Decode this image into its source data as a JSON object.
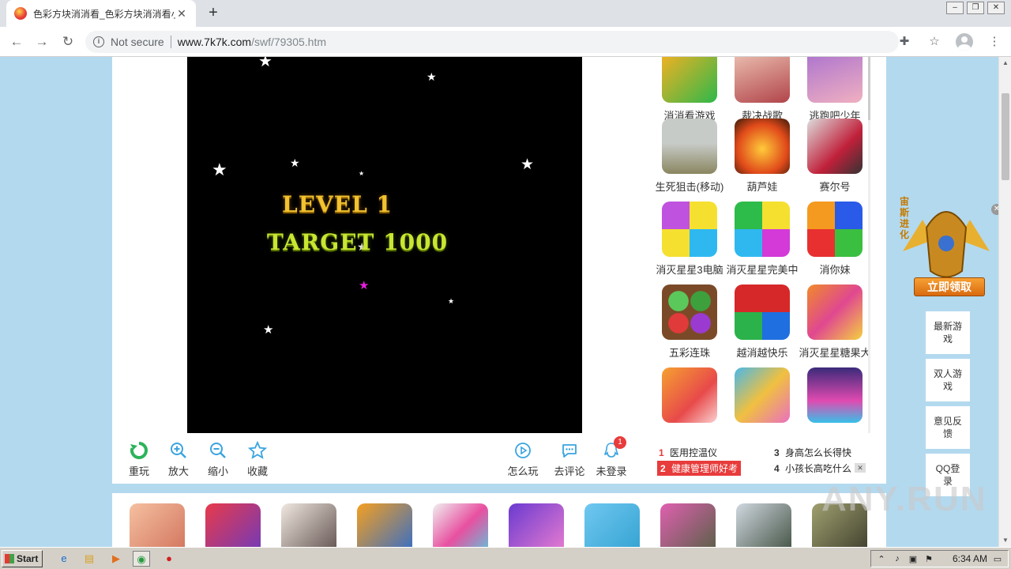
{
  "browser": {
    "tab_title": "色彩方块消消看_色彩方块消消看小游戏",
    "tab_close": "✕",
    "new_tab": "+",
    "security_label": "Not secure",
    "url_host": "www.7k7k.com",
    "url_path": "/swf/79305.htm"
  },
  "game": {
    "level_text": "LEVEL 1",
    "target_text": "TARGET 1000"
  },
  "controls": {
    "replay": "重玩",
    "zoom_in": "放大",
    "zoom_out": "缩小",
    "favorite": "收藏",
    "how_to_play": "怎么玩",
    "comment": "去评论",
    "login": "未登录",
    "login_badge": "1"
  },
  "sidebar_games": [
    {
      "name": "消消看游戏"
    },
    {
      "name": "裁决战歌"
    },
    {
      "name": "逃跑吧少年"
    },
    {
      "name": "生死狙击(移动)"
    },
    {
      "name": "葫芦娃"
    },
    {
      "name": "赛尔号"
    },
    {
      "name": "消灭星星3电脑"
    },
    {
      "name": "消灭星星完美中"
    },
    {
      "name": "消你妹"
    },
    {
      "name": "五彩连珠"
    },
    {
      "name": "越消越快乐"
    },
    {
      "name": "消灭星星糖果大"
    }
  ],
  "hotlist": [
    {
      "num": "1",
      "text": "医用控温仪"
    },
    {
      "num": "2",
      "text": "健康管理师好考"
    },
    {
      "num": "3",
      "text": "身高怎么长得快"
    },
    {
      "num": "4",
      "text": "小孩长高吃什么"
    }
  ],
  "hotlist_close": "✕",
  "floating_ad": {
    "vertical_text": "宙斯进化",
    "button": "立即领取",
    "close": "✕"
  },
  "side_nav": [
    {
      "label": "最新游戏"
    },
    {
      "label": "双人游戏"
    },
    {
      "label": "意见反馈"
    },
    {
      "label": "QQ登录"
    }
  ],
  "watermark": "ANY.RUN",
  "taskbar": {
    "start": "Start",
    "clock": "6:34 AM"
  }
}
